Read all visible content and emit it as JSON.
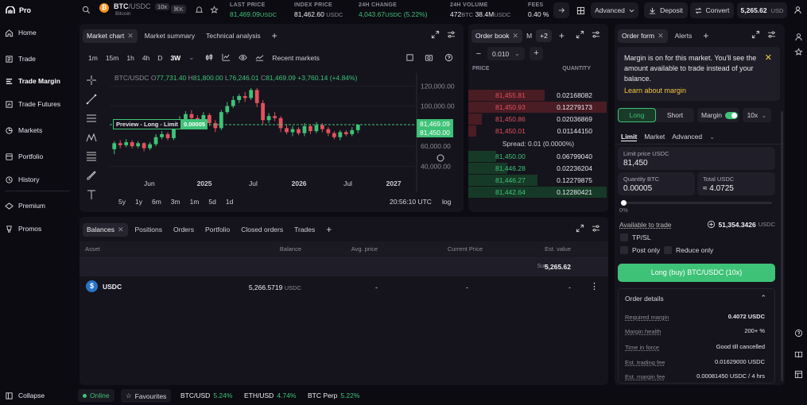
{
  "app": {
    "logo": "Pro"
  },
  "sidebar": {
    "items": [
      {
        "label": "Home",
        "icon": "home-icon"
      },
      {
        "label": "Trade",
        "icon": "trade-icon"
      },
      {
        "label": "Trade Margin",
        "icon": "trade-margin-icon"
      },
      {
        "label": "Trade Futures",
        "icon": "futures-icon"
      },
      {
        "label": "Markets",
        "icon": "markets-icon"
      },
      {
        "label": "Portfolio",
        "icon": "portfolio-icon"
      },
      {
        "label": "History",
        "icon": "history-icon"
      },
      {
        "label": "Premium",
        "icon": "premium-icon"
      },
      {
        "label": "Promos",
        "icon": "promos-icon"
      }
    ],
    "collapse": "Collapse"
  },
  "header": {
    "pair_base": "BTC",
    "pair_quote": "/USDC",
    "leverage_badge": "10x",
    "asset_name": "Bitcoin",
    "shortcut": "⌘K",
    "last_price_label": "LAST PRICE",
    "last_price": "81,469.09",
    "last_price_ccy": "USDC",
    "index_price_label": "INDEX PRICE",
    "index_price": "81,462.60",
    "index_price_ccy": "USDC",
    "change_label": "24H CHANGE",
    "change_value": "4,043.67",
    "change_ccy": "USDC",
    "change_pct": "(5.22%)",
    "volume_label": "24H VOLUME",
    "volume_btc": "472",
    "volume_btc_unit": "BTC",
    "volume_usd": "38.4M",
    "volume_usd_unit": "USDC",
    "fees_label": "FEES",
    "fees_value": "0.40 %",
    "advanced_label": "Advanced",
    "deposit_label": "Deposit",
    "convert_label": "Convert",
    "balance": "5,265.62",
    "balance_ccy": "USD"
  },
  "chart_panel": {
    "tabs": [
      "Market chart",
      "Market summary",
      "Technical analysis"
    ],
    "timeframes": [
      "1m",
      "15m",
      "1h",
      "4h",
      "D",
      "3W"
    ],
    "recent_markets": "Recent markets",
    "ohlc": {
      "pair": "BTC/USDC",
      "o_label": "O",
      "o": "77,731.40",
      "h_label": "H",
      "h": "81,800.00",
      "l_label": "L",
      "l": "76,246.01",
      "c_label": "C",
      "c": "81,469.09",
      "chg": "+3,760.14 (+4.84%)"
    },
    "preview_label": "Preview - Long - Limit",
    "preview_qty": "0.00005",
    "price_tag_last": "81,469.09",
    "price_tag_limit": "81,450.00",
    "ranges": [
      "5y",
      "1y",
      "6m",
      "3m",
      "1m",
      "5d",
      "1d"
    ],
    "time": "20:56:10 UTC",
    "log": "log"
  },
  "chart_data": {
    "type": "candlestick",
    "yticks": [
      "120,000.00",
      "100,000.00",
      "60,000.00",
      "40,000.00"
    ],
    "ylim": [
      30000,
      125000
    ],
    "xticks": [
      "Jun",
      "2025",
      "Jul",
      "2026",
      "Jul",
      "2027"
    ],
    "candles": [
      [
        57000,
        63000,
        52000,
        65000
      ],
      [
        63000,
        61000,
        58000,
        66000
      ],
      [
        61000,
        64000,
        59000,
        67000
      ],
      [
        64000,
        60000,
        58000,
        66000
      ],
      [
        60000,
        63000,
        58000,
        65000
      ],
      [
        63000,
        58000,
        55000,
        64000
      ],
      [
        58000,
        62000,
        56000,
        64000
      ],
      [
        62000,
        69000,
        60000,
        72000
      ],
      [
        69000,
        72000,
        67000,
        75000
      ],
      [
        72000,
        68000,
        66000,
        74000
      ],
      [
        68000,
        80000,
        66000,
        83000
      ],
      [
        80000,
        86000,
        78000,
        90000
      ],
      [
        86000,
        92000,
        84000,
        95000
      ],
      [
        92000,
        88000,
        85000,
        96000
      ],
      [
        88000,
        85000,
        80000,
        91000
      ],
      [
        85000,
        91000,
        82000,
        94000
      ],
      [
        91000,
        83000,
        80000,
        93000
      ],
      [
        83000,
        78000,
        74000,
        86000
      ],
      [
        78000,
        94000,
        76000,
        96000
      ],
      [
        94000,
        100000,
        92000,
        104000
      ],
      [
        100000,
        106000,
        98000,
        110000
      ],
      [
        106000,
        110000,
        103000,
        112000
      ],
      [
        110000,
        108000,
        104000,
        114000
      ],
      [
        108000,
        116000,
        106000,
        118000
      ],
      [
        116000,
        103000,
        99000,
        118000
      ],
      [
        103000,
        86000,
        82000,
        106000
      ],
      [
        86000,
        90000,
        83000,
        93000
      ],
      [
        90000,
        88000,
        85000,
        94000
      ],
      [
        88000,
        78000,
        74000,
        90000
      ],
      [
        78000,
        74000,
        72000,
        82000
      ],
      [
        74000,
        77000,
        70000,
        80000
      ],
      [
        77000,
        73000,
        71000,
        79000
      ],
      [
        73000,
        80000,
        70000,
        83000
      ],
      [
        80000,
        75000,
        72000,
        82000
      ],
      [
        75000,
        81000,
        73000,
        84000
      ],
      [
        81000,
        77000,
        74000,
        83000
      ],
      [
        77000,
        73000,
        70000,
        79000
      ],
      [
        73000,
        69000,
        67000,
        75000
      ],
      [
        69000,
        74000,
        66000,
        76000
      ],
      [
        74000,
        72000,
        70000,
        76000
      ],
      [
        72000,
        76000,
        70000,
        79000
      ],
      [
        76000,
        81469,
        73000,
        81800
      ]
    ],
    "price_line": 81450
  },
  "orderbook": {
    "tabs": [
      "Order book",
      "M"
    ],
    "more": "+2",
    "tick": "0.010",
    "price_header": "PRICE",
    "qty_header": "QUANTITY",
    "asks": [
      {
        "p": "81,455.81",
        "q": "0.02168082",
        "d": 0.55
      },
      {
        "p": "81,450.93",
        "q": "0.12279173",
        "d": 1.0
      },
      {
        "p": "81,450.86",
        "q": "0.02036869",
        "d": 0.1
      },
      {
        "p": "81,450.01",
        "q": "0.01144150",
        "d": 0.06
      }
    ],
    "spread": "Spread: 0.01 (0.0000%)",
    "bids": [
      {
        "p": "81,450.00",
        "q": "0.06799040",
        "d": 0.2
      },
      {
        "p": "81,446.28",
        "q": "0.02236204",
        "d": 0.28
      },
      {
        "p": "81,446.27",
        "q": "0.12279875",
        "d": 0.5
      },
      {
        "p": "81,442.64",
        "q": "0.12280421",
        "d": 1.0
      }
    ]
  },
  "balances": {
    "tabs": [
      "Balances",
      "Positions",
      "Orders",
      "Portfolio",
      "Closed orders",
      "Trades"
    ],
    "columns": [
      "Asset",
      "Balance",
      "Avg. price",
      "Current Price",
      "Est. value"
    ],
    "sum_label": "Sum",
    "sum_value": "5,265.62",
    "rows": [
      {
        "asset": "USDC",
        "balance": "5,266.5719",
        "balance_ccy": "USDC",
        "avg": "-",
        "current": "-",
        "value": "-"
      }
    ]
  },
  "orderform": {
    "tabs": [
      "Order form",
      "Alerts"
    ],
    "notice": "Margin is on for this market. You'll see the amount available to trade instead of your balance.",
    "notice_link": "Learn about margin",
    "long": "Long",
    "short": "Short",
    "margin": "Margin",
    "leverage": "10x",
    "types": [
      "Limit",
      "Market",
      "Advanced"
    ],
    "limit_label": "Limit price USDC",
    "limit_value": "81,450",
    "qty_label": "Quantity BTC",
    "qty_value": "0.00005",
    "total_label": "Total USDC",
    "total_value": "≈ 4.0725",
    "slider_pct": "0%",
    "slider_value": 0,
    "available_label": "Available to trade",
    "available_value": "51,354.3426",
    "available_ccy": "USDC",
    "tpsl": "TP/SL",
    "post_only": "Post only",
    "reduce_only": "Reduce only",
    "submit": "Long (buy) BTC/USDC (10x)",
    "details_title": "Order details",
    "details": [
      {
        "k": "Required margin",
        "v": "0.4072 USDC"
      },
      {
        "k": "Margin health",
        "v": "200+ %"
      },
      {
        "k": "Time in force",
        "v": "Good till cancelled"
      },
      {
        "k": "Est. trading fee",
        "v": "0.01629000 USDC"
      },
      {
        "k": "Est. margin fee",
        "v": "0.00081450 USDC / 4 hrs"
      }
    ]
  },
  "footer": {
    "status": "Online",
    "favourites": "Favourites",
    "tickers": [
      {
        "sym": "BTC/USD",
        "chg": "5.24%"
      },
      {
        "sym": "ETH/USD",
        "chg": "4.74%"
      },
      {
        "sym": "BTC Perp",
        "chg": "5.22%"
      }
    ]
  },
  "colors": {
    "green": "#3ec277",
    "red": "#e2515e",
    "accent": "#3ec277",
    "bg": "#0c0b12",
    "panel": "#15141c"
  }
}
